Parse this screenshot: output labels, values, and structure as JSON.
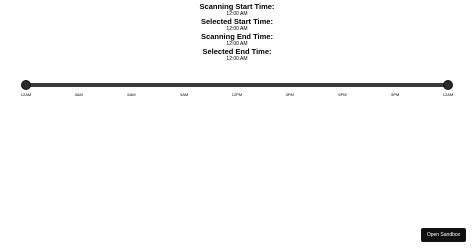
{
  "info": [
    {
      "label": "Scanning Start Time:",
      "value": "12:00 AM"
    },
    {
      "label": "Selected Start Time:",
      "value": "12:00 AM"
    },
    {
      "label": "Scanning End Time:",
      "value": "12:00 AM"
    },
    {
      "label": "Selected End Time:",
      "value": "12:00 AM"
    }
  ],
  "slider": {
    "ticks": [
      "12AM",
      "3AM",
      "6AM",
      "9AM",
      "12PM",
      "3PM",
      "6PM",
      "9PM",
      "12AM"
    ],
    "start_fraction": 0,
    "end_fraction": 1,
    "track_color": "#3a3a3a",
    "thumb_color": "#2b2b2b"
  },
  "sandbox": {
    "label": "Open Sandbox"
  }
}
